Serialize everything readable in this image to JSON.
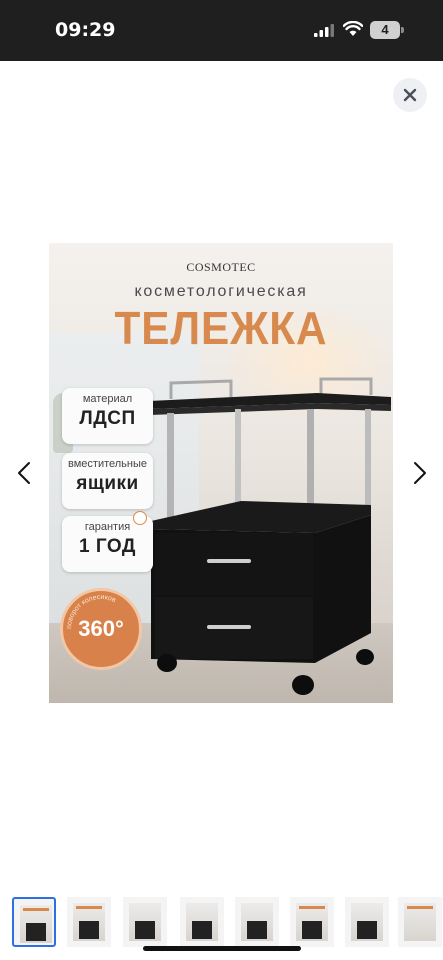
{
  "status_bar": {
    "time": "09:29",
    "battery_level": "4"
  },
  "product": {
    "brand": "COSMOTEC",
    "subtitle": "косметологическая",
    "title": "ТЕЛЕЖКА",
    "features": [
      {
        "small": "материал",
        "big": "ЛДСП"
      },
      {
        "small": "вместительные",
        "big": "ящики"
      },
      {
        "small": "гарантия",
        "big": "1 ГОД"
      }
    ],
    "badge": {
      "value": "360°",
      "ring_text": "поворот колесиков"
    }
  },
  "gallery": {
    "thumbnail_count": 8,
    "selected_index": 0
  },
  "colors": {
    "accent": "#d88a4e",
    "status_bar_bg": "#1f1f1f",
    "selection": "#2f6fe0"
  },
  "icons": [
    "signal-icon",
    "wifi-icon",
    "battery-icon",
    "close-icon",
    "chevron-left-icon",
    "chevron-right-icon"
  ]
}
